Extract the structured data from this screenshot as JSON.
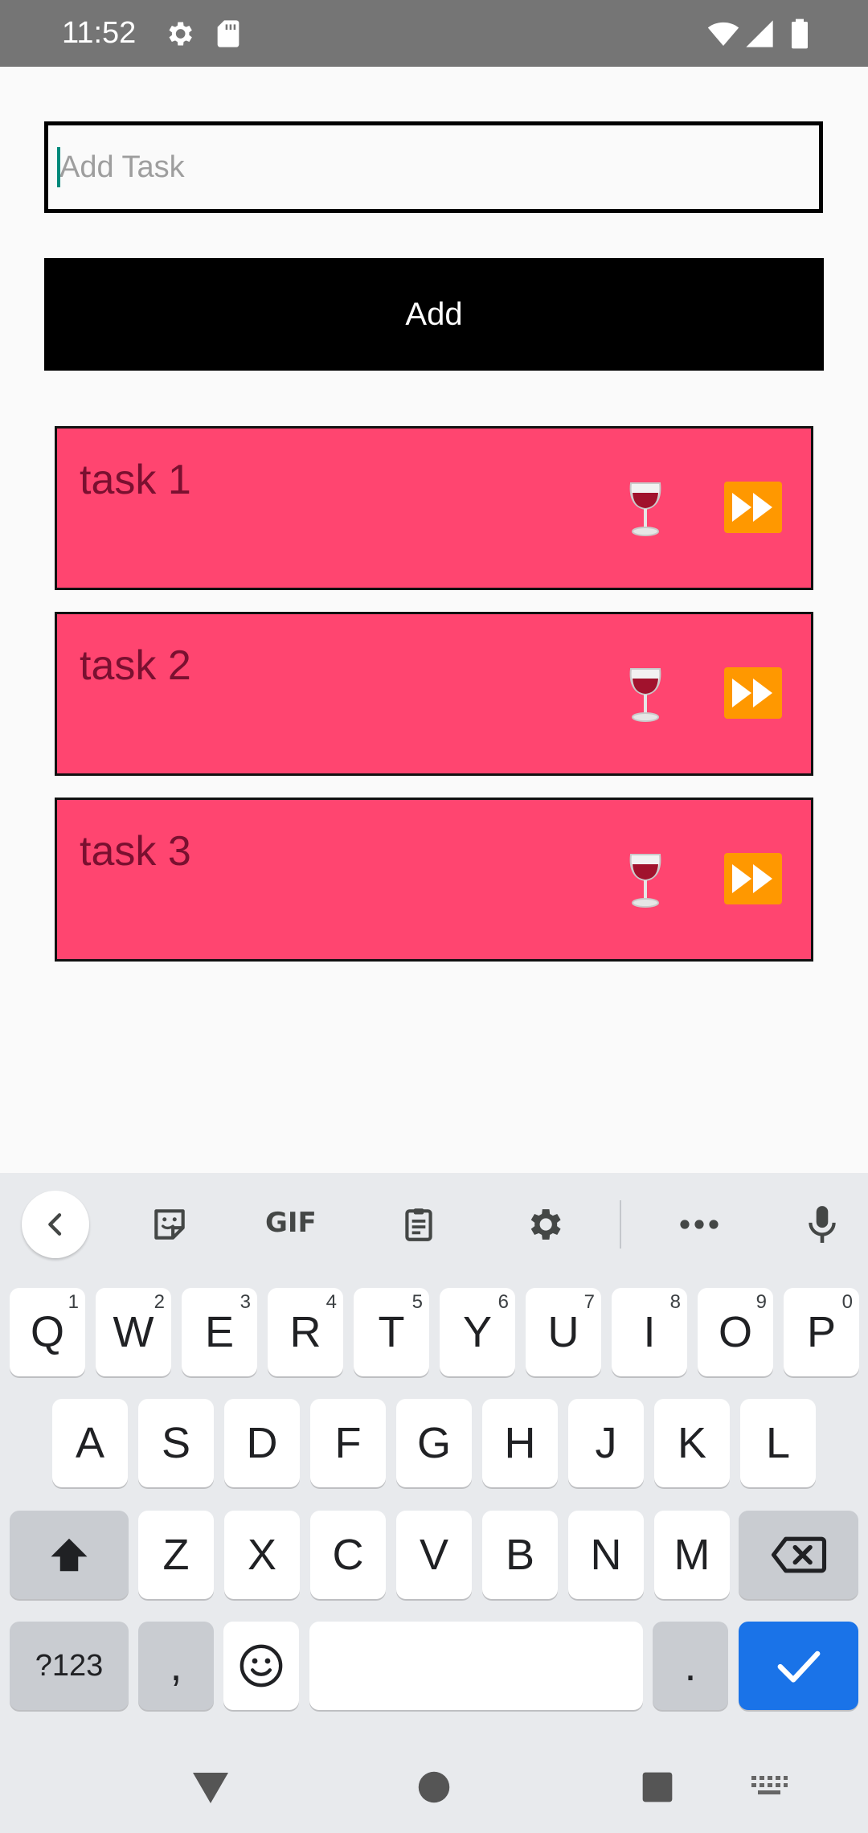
{
  "status_bar": {
    "time": "11:52"
  },
  "task_input": {
    "placeholder": "Add Task",
    "value": ""
  },
  "add_button": {
    "label": "Add"
  },
  "tasks": [
    {
      "title": "task 1"
    },
    {
      "title": "task 2"
    },
    {
      "title": "task 3"
    }
  ],
  "keyboard": {
    "toolbar": {
      "gif_label": "GIF"
    },
    "row1": [
      {
        "label": "Q",
        "hint": "1"
      },
      {
        "label": "W",
        "hint": "2"
      },
      {
        "label": "E",
        "hint": "3"
      },
      {
        "label": "R",
        "hint": "4"
      },
      {
        "label": "T",
        "hint": "5"
      },
      {
        "label": "Y",
        "hint": "6"
      },
      {
        "label": "U",
        "hint": "7"
      },
      {
        "label": "I",
        "hint": "8"
      },
      {
        "label": "O",
        "hint": "9"
      },
      {
        "label": "P",
        "hint": "0"
      }
    ],
    "row2": [
      "A",
      "S",
      "D",
      "F",
      "G",
      "H",
      "J",
      "K",
      "L"
    ],
    "row3": [
      "Z",
      "X",
      "C",
      "V",
      "B",
      "N",
      "M"
    ],
    "row4": {
      "symbols_label": "?123",
      "comma_label": ",",
      "period_label": "."
    }
  },
  "colors": {
    "status_bar": "#757575",
    "task_card": "#ff4570",
    "add_button": "#000000",
    "enter_key": "#1a73e8",
    "ff_icon": "#ff9800"
  },
  "icons": {
    "status_bar": [
      "settings-gear-icon",
      "sd-card-icon",
      "wifi-icon",
      "cell-signal-icon",
      "battery-icon"
    ],
    "task_actions": [
      "wine-glass-icon",
      "fast-forward-icon"
    ],
    "keyboard_toolbar": [
      "back-arrow-icon",
      "sticker-icon",
      "gif-icon",
      "clipboard-icon",
      "settings-icon",
      "more-icon",
      "microphone-icon"
    ],
    "nav_bar": [
      "back-triangle-icon",
      "home-circle-icon",
      "recents-square-icon",
      "keyboard-switch-icon"
    ]
  }
}
